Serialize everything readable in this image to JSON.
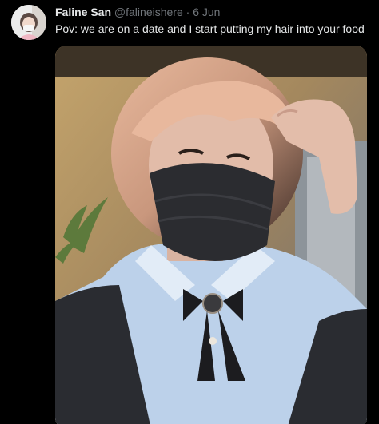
{
  "tweet": {
    "display_name": "Faline San",
    "handle": "@falineishere",
    "separator": "·",
    "date": "6 Jun",
    "text": "Pov: we are on a date and I start putting my hair into your food"
  },
  "media": {
    "type": "photo"
  }
}
